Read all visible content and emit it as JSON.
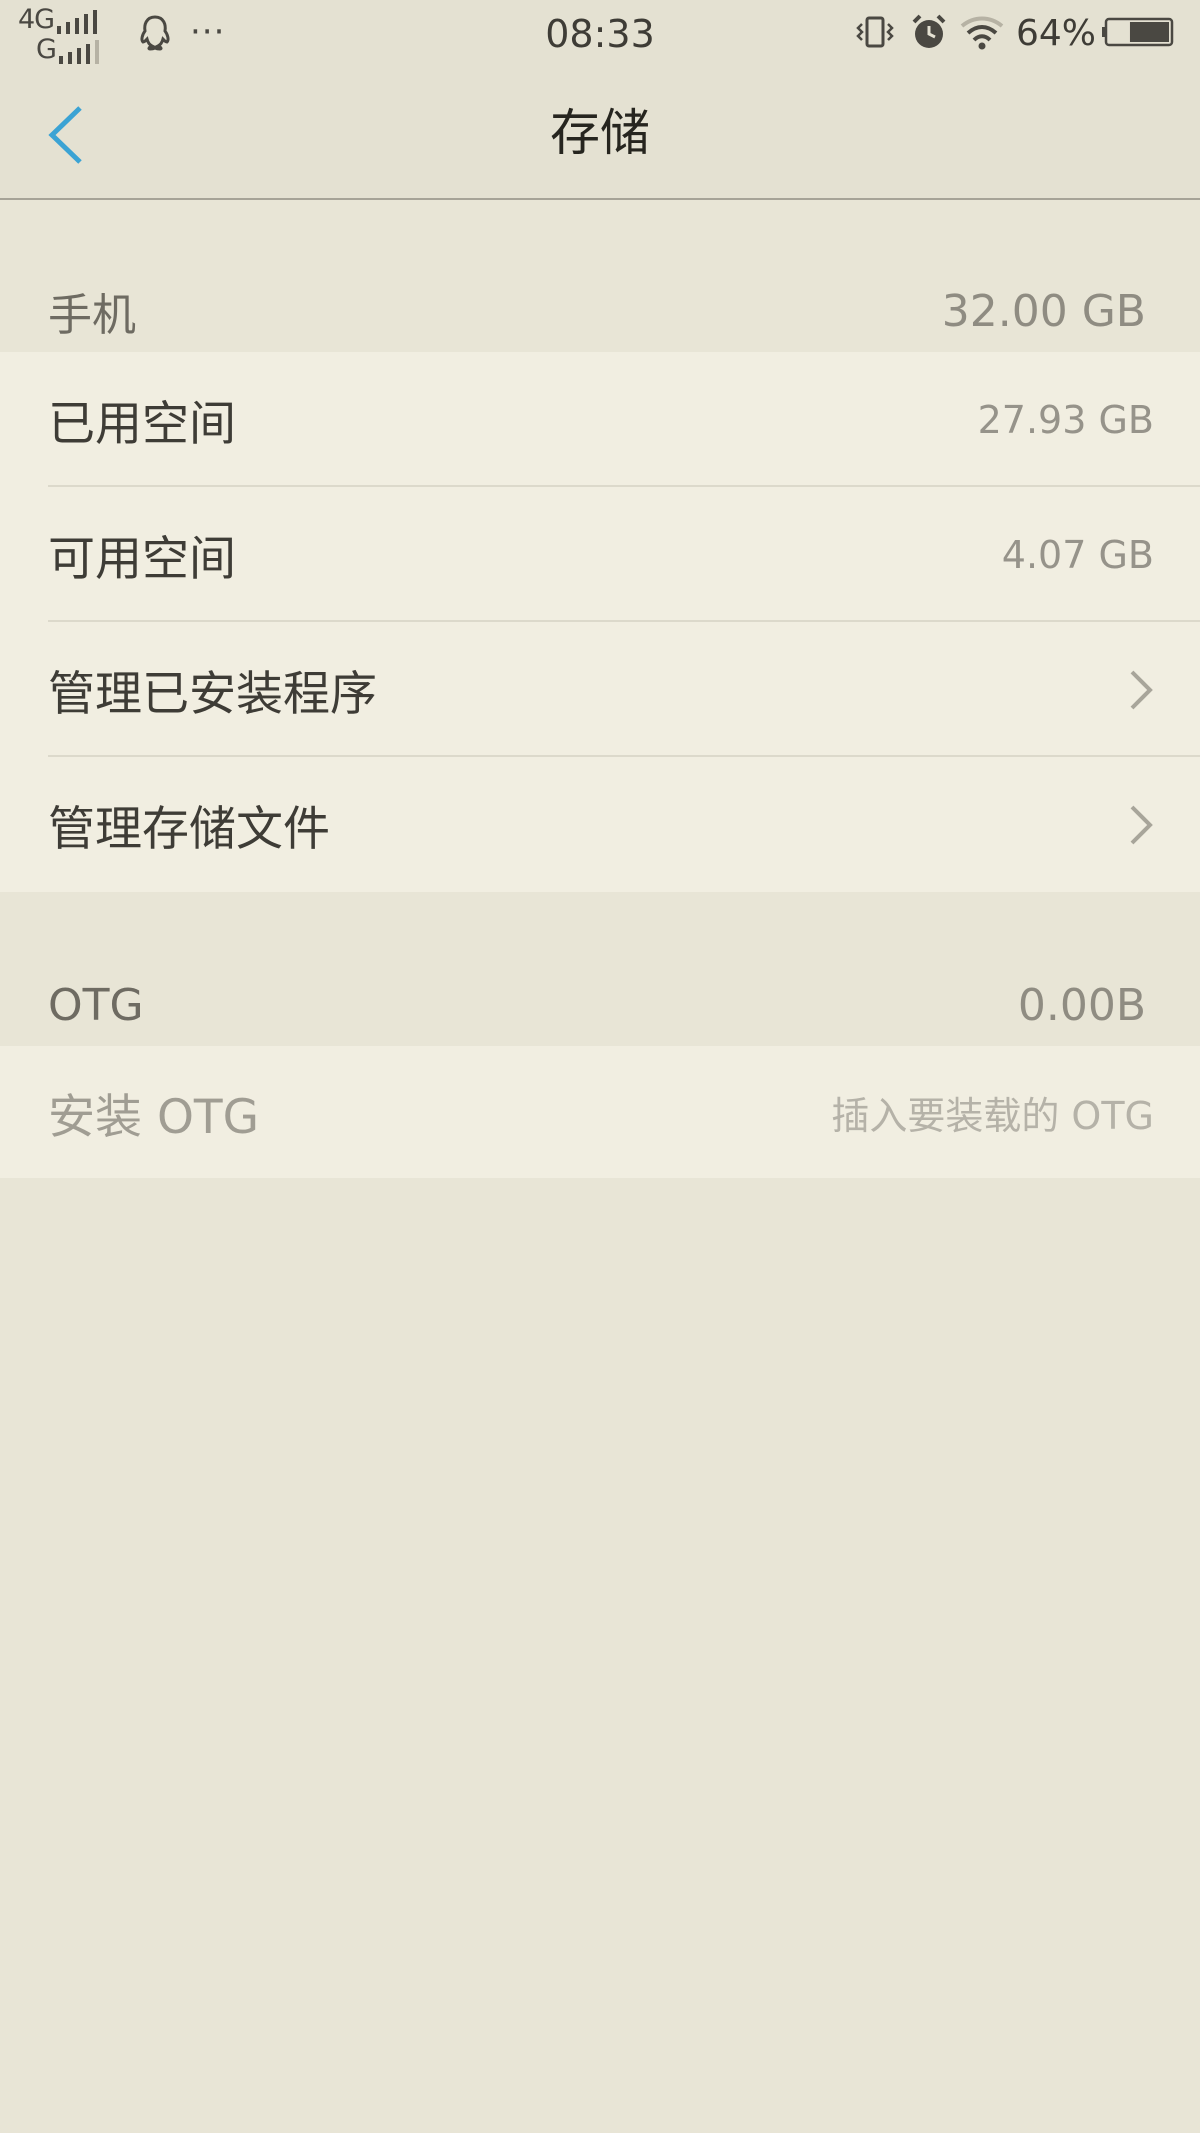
{
  "status_bar": {
    "network_top": "4G",
    "network_bottom": "G",
    "more": "···",
    "time": "08:33",
    "battery_percent": "64%",
    "battery_level": 0.64,
    "icons": [
      "signal-icon",
      "qq-icon",
      "vibrate-icon",
      "alarm-icon",
      "wifi-icon",
      "battery-icon"
    ]
  },
  "nav": {
    "title": "存储",
    "back_icon": "chevron-left-icon",
    "accent_color": "#3BA3D4"
  },
  "phone_section": {
    "header": "手机",
    "total": "32.00 GB",
    "rows": [
      {
        "label": "已用空间",
        "value": "27.93 GB"
      },
      {
        "label": "可用空间",
        "value": "4.07 GB"
      },
      {
        "label": "管理已安装程序",
        "icon": "chevron-right-icon"
      },
      {
        "label": "管理存储文件",
        "icon": "chevron-right-icon"
      }
    ]
  },
  "otg_section": {
    "header": "OTG",
    "total": "0.00B",
    "rows": [
      {
        "label": "安装 OTG",
        "value": "插入要装载的 OTG"
      }
    ]
  }
}
